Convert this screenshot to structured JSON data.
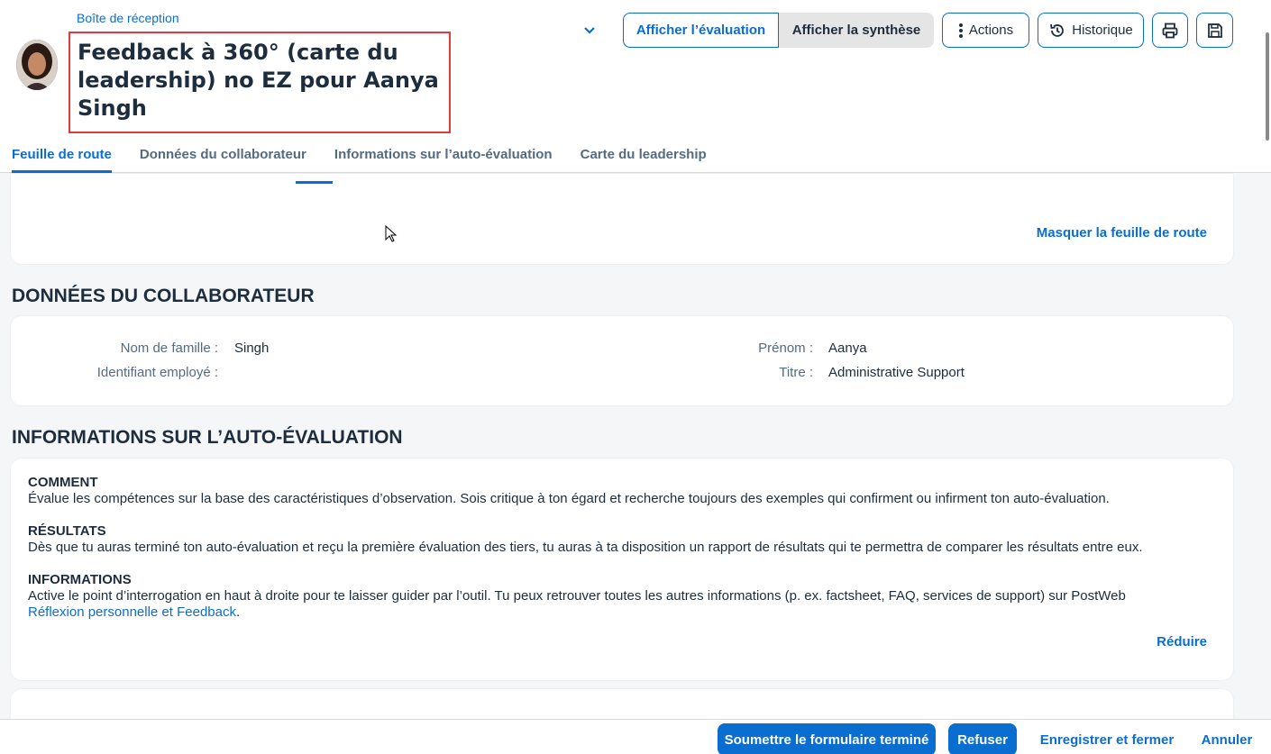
{
  "header": {
    "breadcrumb": "Boîte de réception",
    "title": "Feedback à 360° (carte du leadership) no EZ pour Aanya Singh",
    "view_toggle": {
      "active": "Afficher l’évaluation",
      "inactive": "Afficher la synthèse"
    },
    "actions_label": "Actions",
    "history_label": "Historique"
  },
  "tabs": [
    {
      "label": "Feuille de route"
    },
    {
      "label": "Données du collaborateur"
    },
    {
      "label": "Informations sur l’auto-évaluation"
    },
    {
      "label": "Carte du leadership"
    }
  ],
  "roadmap": {
    "hide_link": "Masquer la feuille de route"
  },
  "employee": {
    "section_title": "DONNÉES DU COLLABORATEUR",
    "last_name_label": "Nom de famille :",
    "last_name_value": "Singh",
    "employee_id_label": "Identifiant employé :",
    "employee_id_value": "",
    "first_name_label": "Prénom :",
    "first_name_value": "Aanya",
    "job_title_label": "Titre :",
    "job_title_value": "Administrative Support"
  },
  "self_eval": {
    "section_title": "INFORMATIONS SUR L’AUTO-ÉVALUATION",
    "blocks": [
      {
        "heading": "COMMENT",
        "text": "Évalue les compétences sur la base des caractéristiques d’observation. Sois critique à ton égard et recherche toujours des exemples qui confirment ou infirment ton auto-évaluation."
      },
      {
        "heading": "RÉSULTATS",
        "text": "Dès que tu auras terminé ton auto-évaluation et reçu la première évaluation des tiers, tu auras à ta disposition un rapport de résultats qui te permettra de comparer les résultats entre eux."
      },
      {
        "heading": "INFORMATIONS",
        "text": "Active le point d’interrogation en haut à droite pour te laisser guider par l’outil. Tu peux retrouver toutes les autres informations (p. ex. factsheet, FAQ, services de support) sur PostWeb",
        "link": "Réflexion personnelle et Feedback",
        "suffix": "."
      }
    ],
    "collapse_link": "Réduire"
  },
  "footer": {
    "submit": "Soumettre le formulaire terminé",
    "refuse": "Refuser",
    "save_close": "Enregistrer et fermer",
    "cancel": "Annuler"
  },
  "colors": {
    "accent": "#0a6ed1",
    "highlight_border": "#e03a3e"
  }
}
